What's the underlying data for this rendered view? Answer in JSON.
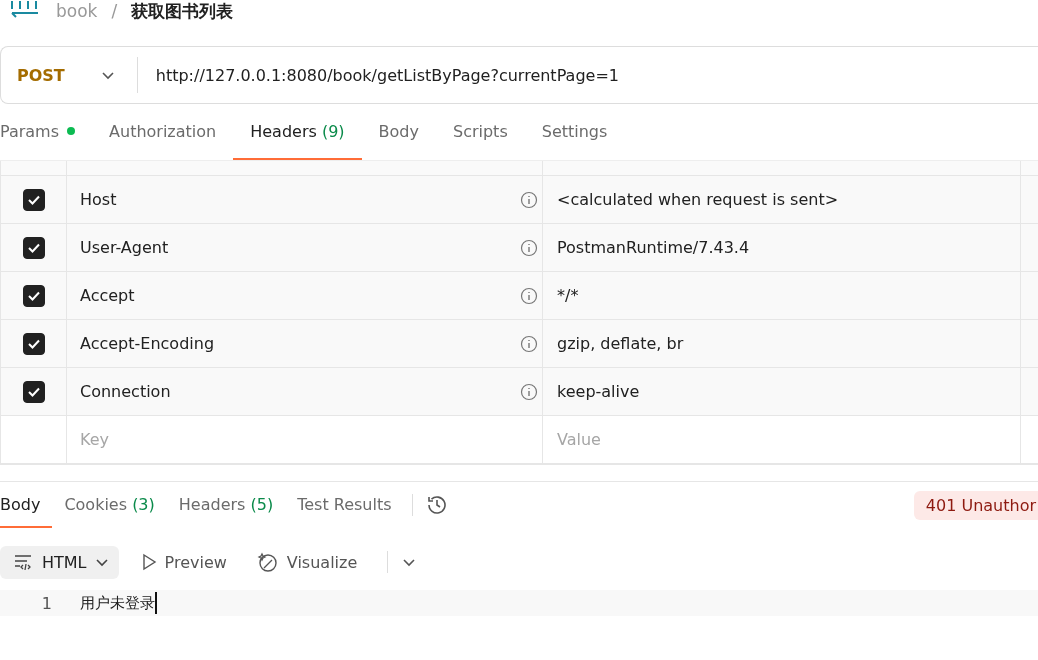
{
  "breadcrumb": {
    "parts": [
      "book",
      "/"
    ],
    "current": "获取图书列表"
  },
  "request": {
    "method": "POST",
    "url": "http://127.0.0.1:8080/book/getListByPage?currentPage=1"
  },
  "request_tabs": [
    {
      "label": "Params",
      "dot": true,
      "selected": false
    },
    {
      "label": "Authorization",
      "dot": false,
      "selected": false
    },
    {
      "label": "Headers",
      "count": "(9)",
      "dot": false,
      "selected": true
    },
    {
      "label": "Body",
      "dot": false,
      "selected": false
    },
    {
      "label": "Scripts",
      "dot": false,
      "selected": false
    },
    {
      "label": "Settings",
      "dot": false,
      "selected": false
    }
  ],
  "headers": [
    {
      "checked": true,
      "key": "Host",
      "value": "<calculated when request is sent>"
    },
    {
      "checked": true,
      "key": "User-Agent",
      "value": "PostmanRuntime/7.43.4"
    },
    {
      "checked": true,
      "key": "Accept",
      "value": "*/*"
    },
    {
      "checked": true,
      "key": "Accept-Encoding",
      "value": "gzip, deflate, br"
    },
    {
      "checked": true,
      "key": "Connection",
      "value": "keep-alive"
    }
  ],
  "new_header": {
    "key_placeholder": "Key",
    "value_placeholder": "Value"
  },
  "response_tabs": [
    {
      "label": "Body",
      "selected": true
    },
    {
      "label": "Cookies",
      "count": "(3)",
      "selected": false
    },
    {
      "label": "Headers",
      "count": "(5)",
      "selected": false
    },
    {
      "label": "Test Results",
      "selected": false
    }
  ],
  "status": "401 Unauthor",
  "view": {
    "format": "HTML",
    "preview": "Preview",
    "visualize": "Visualize"
  },
  "lines": [
    {
      "number": "1",
      "text": "用户未登录"
    }
  ]
}
